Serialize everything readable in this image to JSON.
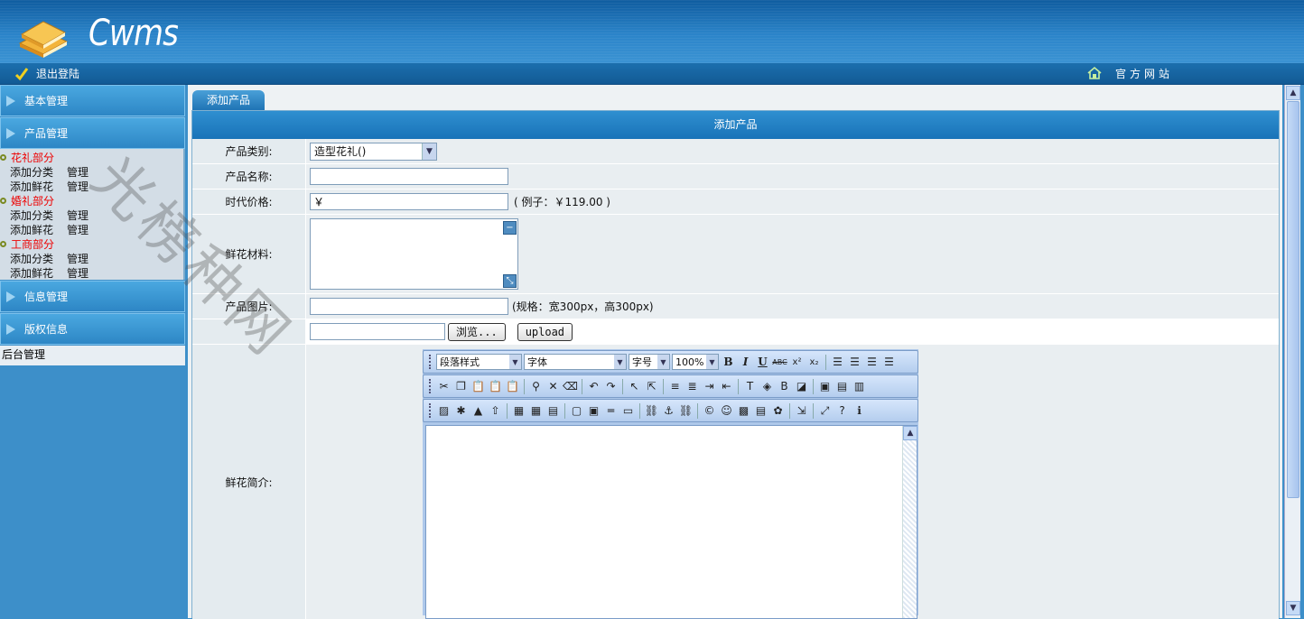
{
  "header": {
    "logo_text": "Cwms",
    "logout_label": "退出登陆",
    "official_site_label": "官方网站"
  },
  "sidebar": {
    "menus": [
      {
        "label": "基本管理"
      },
      {
        "label": "产品管理"
      },
      {
        "label": "信息管理"
      },
      {
        "label": "版权信息"
      }
    ],
    "categories": [
      {
        "name": "花礼部分",
        "rows": [
          [
            "添加分类",
            "管理"
          ],
          [
            "添加鲜花",
            "管理"
          ]
        ]
      },
      {
        "name": "婚礼部分",
        "rows": [
          [
            "添加分类",
            "管理"
          ],
          [
            "添加鲜花",
            "管理"
          ]
        ]
      },
      {
        "name": "工商部分",
        "rows": [
          [
            "添加分类",
            "管理"
          ],
          [
            "添加鲜花",
            "管理"
          ]
        ]
      }
    ],
    "footer_label": "后台管理"
  },
  "main": {
    "tab_label": "添加产品",
    "panel_title": "添加产品",
    "form": {
      "category_label": "产品类别:",
      "category_value": "造型花礼()",
      "name_label": "产品名称:",
      "name_value": "",
      "price_label": "时代价格:",
      "price_value": "￥",
      "price_hint": "( 例子：￥119.00 )",
      "material_label": "鲜花材料:",
      "image_label": "产品图片:",
      "image_value": "",
      "image_hint": "(规格：宽300px，高300px)",
      "browse_label": "浏览...",
      "upload_label": "upload",
      "intro_label": "鲜花简介:"
    },
    "editor": {
      "paragraph_style": "段落样式",
      "font": "字体",
      "font_size": "字号",
      "zoom": "100%"
    }
  },
  "watermark": "光榜种网"
}
